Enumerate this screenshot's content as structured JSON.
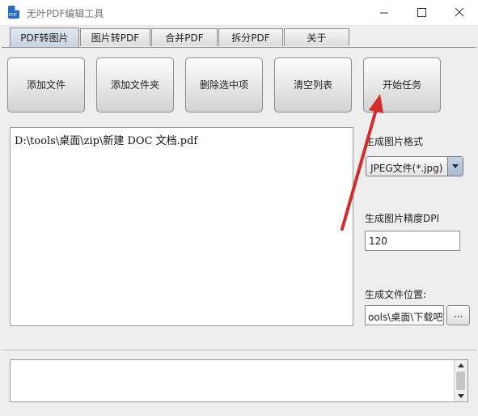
{
  "window": {
    "title": "无叶PDF编辑工具"
  },
  "tabs": [
    {
      "label": "PDF转图片",
      "active": true
    },
    {
      "label": "图片转PDF",
      "active": false
    },
    {
      "label": "合并PDF",
      "active": false
    },
    {
      "label": "拆分PDF",
      "active": false
    },
    {
      "label": "关于",
      "active": false
    }
  ],
  "toolbar": {
    "add_file": "添加文件",
    "add_folder": "添加文件夹",
    "delete_selected": "删除选中项",
    "clear_list": "清空列表",
    "start_task": "开始任务"
  },
  "file_list": {
    "items": [
      "D:\\tools\\桌面\\zip\\新建 DOC 文档.pdf"
    ]
  },
  "settings": {
    "format_label": "生成图片格式",
    "format_value": "JPEG文件(*.jpg)",
    "dpi_label": "生成图片精度DPI",
    "dpi_value": "120",
    "output_label": "生成文件位置:",
    "output_value": "ools\\桌面\\下载吧",
    "browse_label": "..."
  },
  "log": {
    "text": ""
  },
  "colors": {
    "annotation_arrow": "#d62b2b",
    "active_tab": "#c7d3e2"
  }
}
